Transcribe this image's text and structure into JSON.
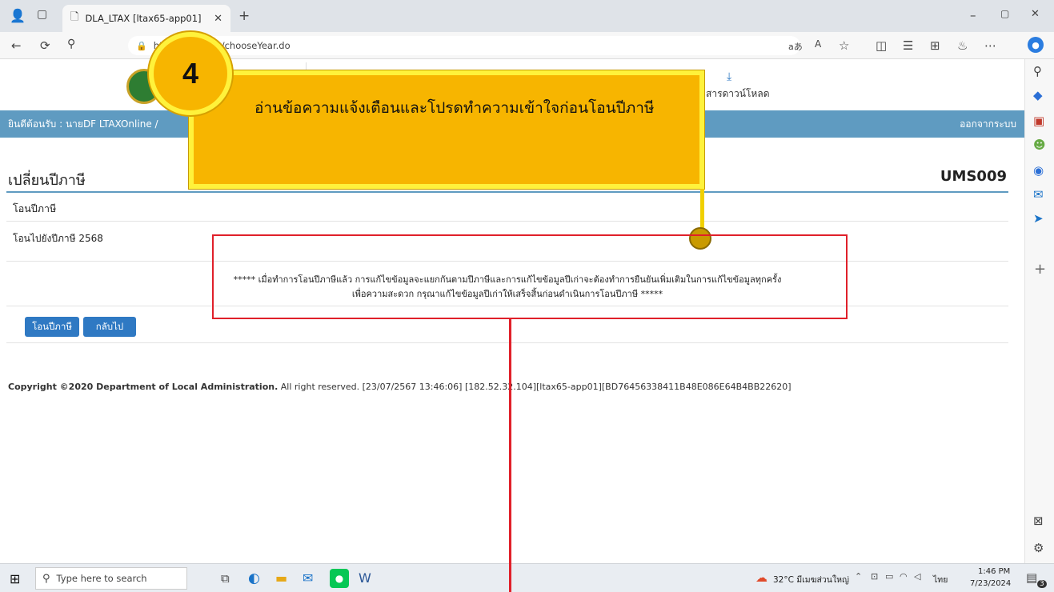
{
  "browser": {
    "tab_title": "DLA_LTAX [ltax65-app01]",
    "url": "https://               th/ums/chooseYear.do",
    "reader_label": "aあ",
    "window_controls": [
      "–",
      "▢",
      "✕"
    ]
  },
  "header": {
    "download_label": "สารดาวน์โหลด"
  },
  "welcome": {
    "user_text": "ยินดีต้อนรับ : นายDF LTAXOnline /",
    "logout_label": "ออกจากระบบ"
  },
  "page": {
    "title": "เปลี่ยนปีภาษี",
    "code": "UMS009",
    "section_label": "โอนปีภาษี",
    "target_year_label": "โอนไปยังปีภาษี 2568",
    "warning_line1": "***** เมื่อทำการโอนปีภาษีแล้ว การแก้ไขข้อมูลจะแยกกันตามปีภาษีและการแก้ไขข้อมูลปีเก่าจะต้องทำการยืนยันเพิ่มเติมในการแก้ไขข้อมูลทุกครั้ง",
    "warning_line2": "เพื่อความสะดวก กรุณาแก้ไขข้อมูลปีเก่าให้เสร็จสิ้นก่อนดำเนินการโอนปีภาษี *****",
    "transfer_button": "โอนปีภาษี",
    "back_button": "กลับไป",
    "copyright_bold": "Copyright ©2020 Department of Local Administration.",
    "copyright_rest": " All right reserved. [23/07/2567 13:46:06] [182.52.32.104][ltax65-app01][BD76456338411B48E086E64B4BB22620]"
  },
  "callout": {
    "step_number": "4",
    "text": "อ่านข้อความแจ้งเตือนและโปรดทำความเข้าใจก่อนโอนปีภาษี"
  },
  "taskbar": {
    "search_placeholder": "Type here to search",
    "weather": "32°C มีเมฆส่วนใหญ่",
    "language": "ไทย",
    "time": "1:46 PM",
    "date": "7/23/2024",
    "notification_count": "3"
  },
  "colors": {
    "welcome_bar": "#5f9bc1",
    "button": "#2f79c3",
    "callout_fill": "#f7b500",
    "callout_border": "#fff23b",
    "highlight_red": "#e0202a"
  }
}
